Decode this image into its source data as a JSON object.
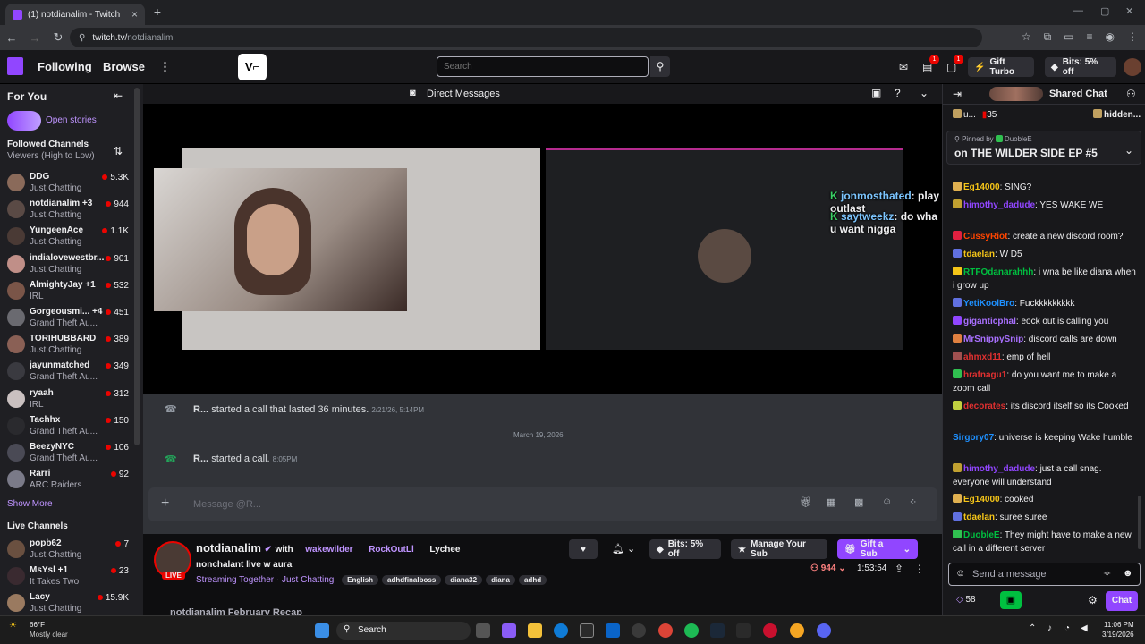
{
  "browser": {
    "tab_title": "(1) notdianalim - Twitch",
    "url_host": "twitch.tv/",
    "url_path": "notdianalim"
  },
  "topnav": {
    "following": "Following",
    "browse": "Browse",
    "search_placeholder": "Search",
    "gift_turbo": "Gift Turbo",
    "bits": "Bits: 5% off",
    "inbox_badge": "1",
    "notif_badge": "1"
  },
  "sidebar": {
    "for_you": "For You",
    "open_stories": "Open stories",
    "followed_title": "Followed Channels",
    "followed_sort": "Viewers (High to Low)",
    "channels": [
      {
        "name": "DDG",
        "game": "Just Chatting",
        "viewers": "5.3K",
        "color": "#8a6a5a"
      },
      {
        "name": "notdianalim +3",
        "game": "Just Chatting",
        "viewers": "944",
        "color": "#5a4a45"
      },
      {
        "name": "YungeenAce",
        "game": "Just Chatting",
        "viewers": "1.1K",
        "color": "#4a3a35"
      },
      {
        "name": "indialovewestbr...",
        "game": "Just Chatting",
        "viewers": "901",
        "color": "#c08f88"
      },
      {
        "name": "AlmightyJay +1",
        "game": "IRL",
        "viewers": "532",
        "color": "#7a5548"
      },
      {
        "name": "Gorgeousmi... +4",
        "game": "Grand Theft Au...",
        "viewers": "451",
        "color": "#6a6a70"
      },
      {
        "name": "TORIHUBBARD",
        "game": "Just Chatting",
        "viewers": "389",
        "color": "#8a6055"
      },
      {
        "name": "jayunmatched",
        "game": "Grand Theft Au...",
        "viewers": "349",
        "color": "#3a3a40"
      },
      {
        "name": "ryaah",
        "game": "IRL",
        "viewers": "312",
        "color": "#c9c0c0"
      },
      {
        "name": "Tachhx",
        "game": "Grand Theft Au...",
        "viewers": "150",
        "color": "#2a2a2e"
      },
      {
        "name": "BeezyNYC",
        "game": "Grand Theft Au...",
        "viewers": "106",
        "color": "#4a4a55"
      },
      {
        "name": "Rarri",
        "game": "ARC Raiders",
        "viewers": "92",
        "color": "#7a7a88"
      }
    ],
    "show_more": "Show More",
    "live_title": "Live Channels",
    "live": [
      {
        "name": "popb62",
        "game": "Just Chatting",
        "viewers": "7",
        "color": "#6a5040"
      },
      {
        "name": "MsYsl +1",
        "game": "It Takes Two",
        "viewers": "23",
        "color": "#3a2a30"
      },
      {
        "name": "Lacy",
        "game": "Just Chatting",
        "viewers": "15.9K",
        "color": "#9a7a60"
      }
    ]
  },
  "main": {
    "dm_title": "Direct Messages",
    "overlay_1_user": "jonmosthated",
    "overlay_1_text": "play outlast",
    "overlay_2_user": "saytweekz",
    "overlay_2_text": "do wha u want nigga",
    "call_msg_1_user": "R...",
    "call_msg_1_text": "started a call that lasted 36 minutes.",
    "call_msg_1_time": "2/21/26, 5:14PM",
    "date_divider": "March 19, 2026",
    "call_msg_2_user": "R...",
    "call_msg_2_text": "started a call.",
    "call_msg_2_time": "8:05PM",
    "message_placeholder": "Message @R..."
  },
  "stream": {
    "streamer": "notdianalim",
    "with": "with",
    "collab_1": "wakewilder",
    "collab_2": "RockOutLl",
    "collab_3": "Lychee",
    "title": "nonchalant live w aura",
    "live": "LIVE",
    "streaming_together": "Streaming Together",
    "category_sep": "·",
    "category": "Just Chatting",
    "tags": [
      "English",
      "adhdfinalboss",
      "diana32",
      "diana",
      "adhd"
    ],
    "bits": "Bits: 5% off",
    "manage_sub": "Manage Your Sub",
    "gift_sub": "Gift a Sub",
    "viewers": "944",
    "uptime": "1:53:54",
    "recap": "notdianalim February Recap"
  },
  "chat": {
    "shared_chat": "Shared Chat",
    "top_1_user": "u...",
    "top_1_count": "35",
    "top_2_user": "hidden...",
    "pinned_by": "Pinned by",
    "pinned_user": "DuobleE",
    "pinned_text": "on THE WILDER SIDE EP #5",
    "messages": [
      {
        "user": "Eg14000",
        "color": "#f5c518",
        "text": ": SING?",
        "icon": "#e0b050"
      },
      {
        "user": "himothy_dadude",
        "color": "#9146ff",
        "text": ": YES WAKE WE",
        "icon": "#c0a030"
      },
      {
        "user": "CussyRiot",
        "color": "#ff4500",
        "text": ": create a new discord room?",
        "icon": "#e02040"
      },
      {
        "user": "tdaelan",
        "color": "#f5c518",
        "text": ": W D5",
        "icon": "#6070e0"
      },
      {
        "user": "RTFOdanarahhh",
        "color": "#00c040",
        "text": ": i wna be like diana when i grow up",
        "icon": "#f5c518"
      },
      {
        "user": "YetiKoolBro",
        "color": "#1e90ff",
        "text": ": Fuckkkkkkkkk",
        "icon": "#6070e0"
      },
      {
        "user": "giganticphal",
        "color": "#a970ff",
        "text": ": eock out is calling you",
        "icon": "#9146ff"
      },
      {
        "user": "MrSnippySnip",
        "color": "#a970ff",
        "text": ": discord calls are down",
        "icon": "#e08040"
      },
      {
        "user": "ahmxd11",
        "color": "#e03030",
        "text": ": emp of hell",
        "icon": "#a05050"
      },
      {
        "user": "hrafnagu1",
        "color": "#e03030",
        "text": ": do you want me to make a zoom call",
        "icon": "#30c050"
      },
      {
        "user": "decorates",
        "color": "#e03030",
        "text": ": its discord itself so its Cooked",
        "icon": "#c0d040"
      },
      {
        "user": "Sirgory07",
        "color": "#1e90ff",
        "text": ": universe is keeping Wake humble",
        "icon": ""
      },
      {
        "user": "himothy_dadude",
        "color": "#9146ff",
        "text": ": just a call snag. everyone will understand",
        "icon": "#c0a030"
      },
      {
        "user": "Eg14000",
        "color": "#f5c518",
        "text": ": cooked",
        "icon": "#e0b050"
      },
      {
        "user": "tdaelan",
        "color": "#f5c518",
        "text": ": suree suree",
        "icon": "#6070e0"
      },
      {
        "user": "DuobleE",
        "color": "#00c040",
        "text": ": They might have to make a new call in a different server",
        "icon": "#30c050"
      }
    ],
    "send_placeholder": "Send a message",
    "points": "58",
    "chat_button": "Chat"
  },
  "taskbar": {
    "weather_temp": "66°F",
    "weather_desc": "Mostly clear",
    "search": "Search",
    "time": "11:06 PM",
    "date": "3/19/2026"
  },
  "colors": {
    "twitch_purple": "#9146ff",
    "live_red": "#eb0400"
  }
}
